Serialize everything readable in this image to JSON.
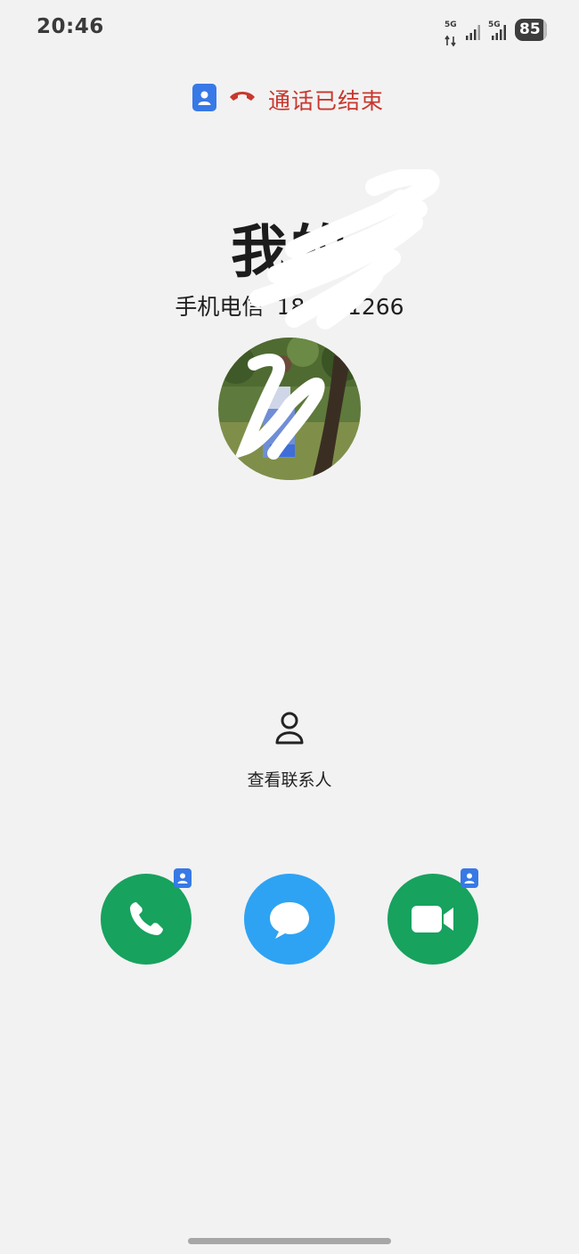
{
  "status_bar": {
    "time": "20:46",
    "network_1": "5G",
    "network_2": "5G",
    "battery_level": "85"
  },
  "call": {
    "status_text": "通话已结束",
    "contact_name": "我的",
    "carrier": "手机电信",
    "number": "18   66 1266"
  },
  "actions": {
    "view_contact_label": "查看联系人"
  },
  "colors": {
    "call_ended": "#c8372d",
    "badge_blue": "#3779e6",
    "call_green": "#17a25e",
    "message_blue": "#2ea3f3"
  },
  "icons": {
    "contact_card": "contact-card-icon",
    "hangup": "phone-hangup-icon",
    "view_contact": "person-outline-icon",
    "call": "phone-icon",
    "message": "chat-bubble-icon",
    "video": "video-camera-icon"
  }
}
